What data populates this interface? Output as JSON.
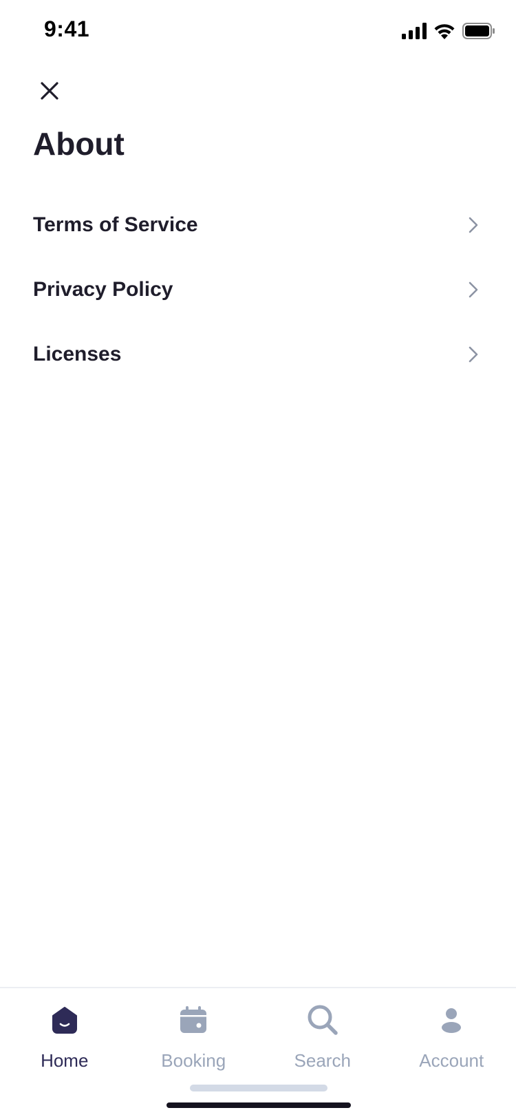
{
  "status_bar": {
    "time": "9:41",
    "icons": [
      "cellular-signal-icon",
      "wifi-icon",
      "battery-icon"
    ]
  },
  "header": {
    "close_icon": "close-icon",
    "title": "About"
  },
  "menu": {
    "items": [
      {
        "label": "Terms of Service",
        "icon": "chevron-right-icon"
      },
      {
        "label": "Privacy Policy",
        "icon": "chevron-right-icon"
      },
      {
        "label": "Licenses",
        "icon": "chevron-right-icon"
      }
    ]
  },
  "tab_bar": {
    "tabs": [
      {
        "label": "Home",
        "icon": "home-icon",
        "active": true
      },
      {
        "label": "Booking",
        "icon": "calendar-icon",
        "active": false
      },
      {
        "label": "Search",
        "icon": "search-icon",
        "active": false
      },
      {
        "label": "Account",
        "icon": "account-icon",
        "active": false
      }
    ]
  },
  "colors": {
    "text_primary": "#1f1d2b",
    "tab_active": "#2e2b57",
    "tab_inactive": "#9aa5b9",
    "chevron": "#8c93a3"
  }
}
